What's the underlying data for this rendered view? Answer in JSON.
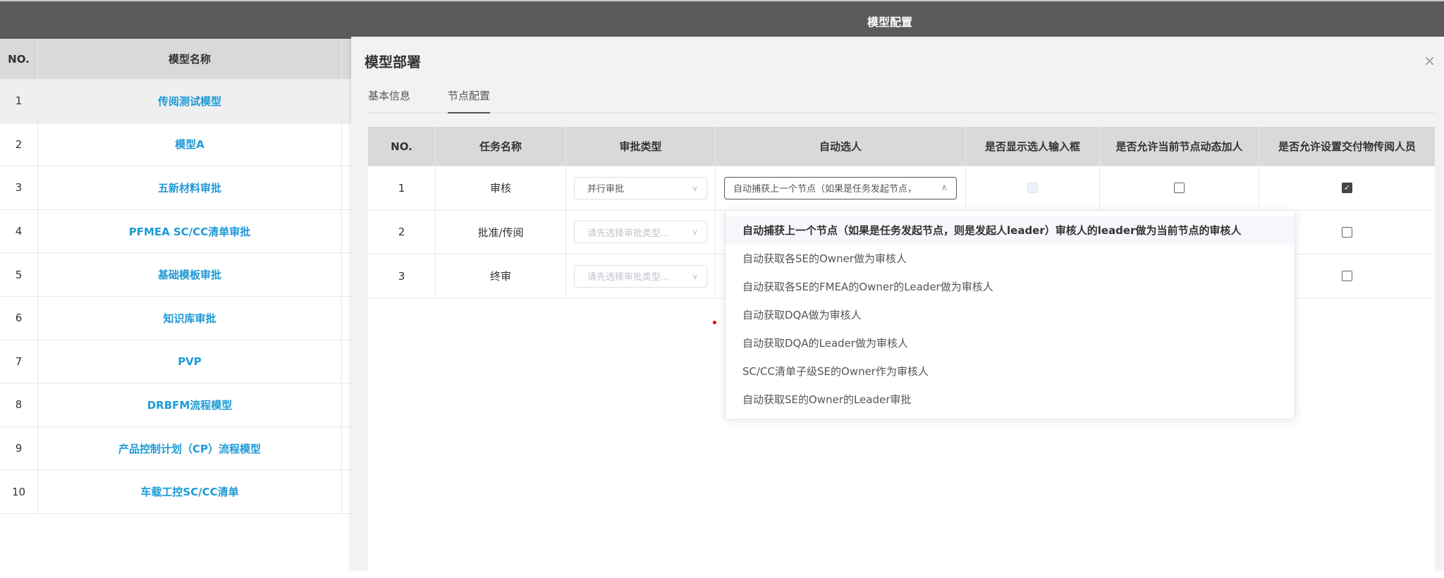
{
  "header": {
    "title": "模型配置"
  },
  "left_table": {
    "columns": [
      "NO.",
      "模型名称"
    ],
    "rows": [
      {
        "no": "1",
        "name": "传阅测试模型"
      },
      {
        "no": "2",
        "name": "模型A"
      },
      {
        "no": "3",
        "name": "五新材料审批"
      },
      {
        "no": "4",
        "name": "PFMEA SC/CC清单审批"
      },
      {
        "no": "5",
        "name": "基础模板审批"
      },
      {
        "no": "6",
        "name": "知识库审批"
      },
      {
        "no": "7",
        "name": "PVP"
      },
      {
        "no": "8",
        "name": "DRBFM流程模型"
      },
      {
        "no": "9",
        "name": "产品控制计划（CP）流程模型"
      },
      {
        "no": "10",
        "name": "车载工控SC/CC清单"
      }
    ]
  },
  "modal": {
    "title": "模型部署",
    "close_icon": "×",
    "tabs": [
      "基本信息",
      "节点配置"
    ],
    "active_tab": "节点配置",
    "table": {
      "columns": [
        "NO.",
        "任务名称",
        "审批类型",
        "自动选人",
        "是否显示选人输入框",
        "是否允许当前节点动态加人",
        "是否允许设置交付物传阅人员"
      ],
      "rows": [
        {
          "no": "1",
          "task": "审核",
          "approval_type": "并行审批",
          "auto": "自动捕获上一个节点（如果是任务发起节点，",
          "show_input": false,
          "allow_dynamic": false,
          "allow_deliverable": true
        },
        {
          "no": "2",
          "task": "批准/传阅",
          "approval_type_placeholder": "请先选择审批类型...",
          "allow_deliverable": false
        },
        {
          "no": "3",
          "task": "终审",
          "approval_type_placeholder": "请先选择审批类型...",
          "allow_deliverable": false
        }
      ]
    },
    "dropdown": {
      "options": [
        "自动捕获上一个节点（如果是任务发起节点，则是发起人leader）审核人的leader做为当前节点的审核人",
        "自动获取各SE的Owner做为审核人",
        "自动获取各SE的FMEA的Owner的Leader做为审核人",
        "自动获取DQA做为审核人",
        "自动获取DQA的Leader做为审核人",
        "SC/CC清单子级SE的Owner作为审核人",
        "自动获取SE的Owner的Leader审批"
      ],
      "highlighted": 0
    }
  }
}
